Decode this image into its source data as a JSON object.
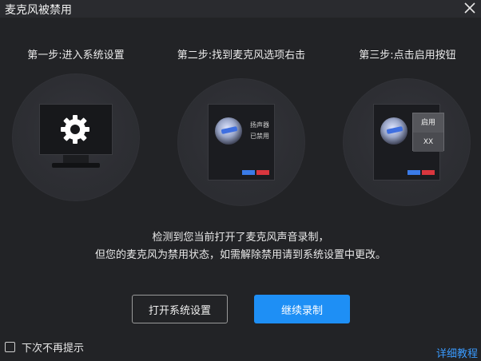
{
  "window": {
    "title": "麦克风被禁用"
  },
  "steps": [
    {
      "label": "第一步:进入系统设置"
    },
    {
      "label": "第二步:找到麦克风选项右击"
    },
    {
      "label": "第三步:点击启用按钮"
    }
  ],
  "step2_dialog": {
    "line1": "扬声器",
    "line2": "已禁用"
  },
  "step3_menu": {
    "enable": "启用",
    "placeholder": "XX"
  },
  "message": {
    "line1": "检测到您当前打开了麦克风声音录制，",
    "line2": "但您的麦克风为禁用状态，如需解除禁用请到系统设置中更改。"
  },
  "buttons": {
    "open_settings": "打开系统设置",
    "continue": "继续录制"
  },
  "footer": {
    "dont_remind": "下次不再提示",
    "detail_link": "详细教程"
  },
  "colors": {
    "accent": "#1e8ff5",
    "link": "#3a9bff",
    "background": "#222326"
  }
}
